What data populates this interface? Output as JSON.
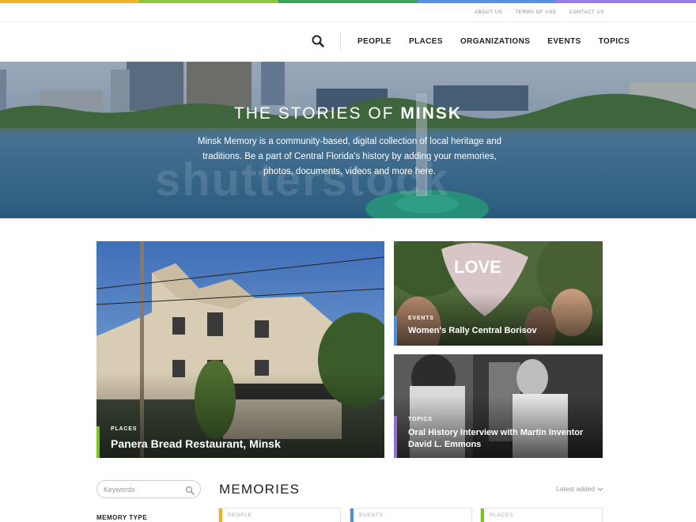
{
  "colors": {
    "stripe": [
      "#f0b429",
      "#8dc63f",
      "#3ba55c",
      "#5b8ee6",
      "#9b7be8"
    ],
    "events": "#4a90e2",
    "places": "#7cc41f",
    "topics": "#8e6fd6",
    "people": "#f2b01e"
  },
  "utility": {
    "about": "ABOUT US",
    "terms": "TERMS OF USE",
    "contact": "CONTACT US"
  },
  "nav": {
    "search_icon": "search-icon",
    "items": [
      "PEOPLE",
      "PLACES",
      "ORGANIZATIONS",
      "EVENTS",
      "TOPICS"
    ]
  },
  "hero": {
    "title_pre": "THE STORIES OF ",
    "title_bold": "MINSK",
    "description": "Minsk Memory is a community-based, digital collection of local heritage and traditions. Be a part of Central Florida's history by adding your memories, photos, documents, videos and more here.",
    "watermark": "shutterstock"
  },
  "featured": [
    {
      "category": "PLACES",
      "title": "Panera Bread Restaurant, Minsk"
    },
    {
      "category": "EVENTS",
      "title": "Women's Rally Central Borisov"
    },
    {
      "category": "TOPICS",
      "title": "Oral History Interview with Martin Inventor David L. Emmons"
    }
  ],
  "sidebar": {
    "keywords_placeholder": "Keywords",
    "memory_type_label": "MEMORY TYPE"
  },
  "memories": {
    "title": "MEMORIES",
    "sort_label": "Latest added",
    "tiles": [
      "PEOPLE",
      "EVENTS",
      "PLACES"
    ]
  }
}
